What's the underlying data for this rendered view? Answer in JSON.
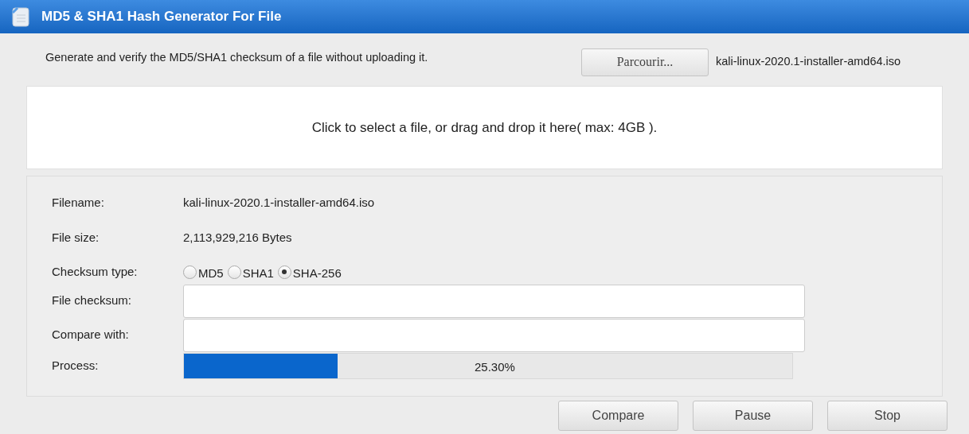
{
  "window": {
    "title": "MD5 & SHA1 Hash Generator For File"
  },
  "header": {
    "description": "Generate and verify the MD5/SHA1 checksum of a file without uploading it.",
    "browse_button": "Parcourir...",
    "chosen_file": "kali-linux-2020.1-installer-amd64.iso"
  },
  "drop_zone": {
    "text": "Click to select a file, or drag and drop it here( max: 4GB )."
  },
  "details": {
    "filename": {
      "label": "Filename:",
      "value": "kali-linux-2020.1-installer-amd64.iso"
    },
    "file_size": {
      "label": "File size:",
      "value": "2,113,929,216 Bytes"
    },
    "checksum_type": {
      "label": "Checksum type:",
      "options": [
        {
          "label": "MD5",
          "selected": false
        },
        {
          "label": "SHA1",
          "selected": false
        },
        {
          "label": "SHA-256",
          "selected": true
        }
      ]
    },
    "file_checksum": {
      "label": "File checksum:"
    },
    "compare_with": {
      "label": "Compare with:"
    },
    "process": {
      "label": "Process:",
      "level": 0.253,
      "reading": "25.30%"
    }
  },
  "buttons": [
    "Compare",
    "Pause",
    "Stop"
  ]
}
